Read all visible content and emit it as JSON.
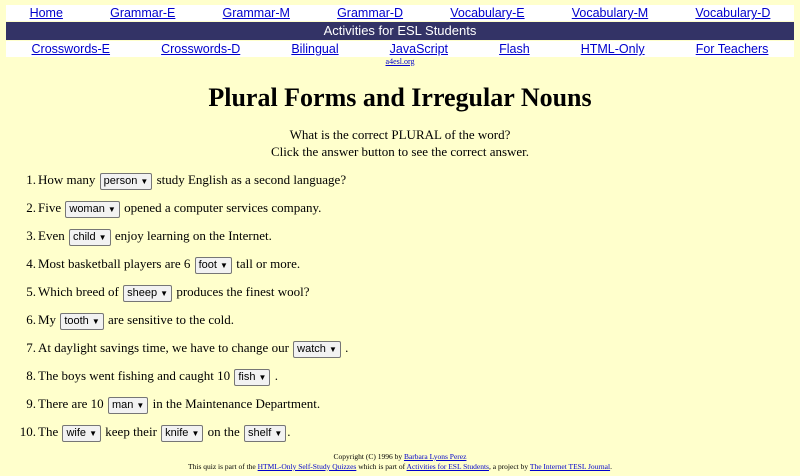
{
  "nav_top": [
    "Home",
    "Grammar-E",
    "Grammar-M",
    "Grammar-D",
    "Vocabulary-E",
    "Vocabulary-M",
    "Vocabulary-D"
  ],
  "banner": "Activities for ESL Students",
  "nav_bottom": [
    "Crosswords-E",
    "Crosswords-D",
    "Bilingual",
    "JavaScript",
    "Flash",
    "HTML-Only",
    "For Teachers"
  ],
  "site_link": "a4esl.org",
  "title": "Plural Forms and Irregular Nouns",
  "intro": [
    "What is the correct PLURAL of the word?",
    "Click the answer button to see the correct answer."
  ],
  "questions": [
    {
      "num": "1.",
      "parts": [
        "How many ",
        {
          "sel": "person"
        },
        " study English as a second language?"
      ]
    },
    {
      "num": "2.",
      "parts": [
        "Five ",
        {
          "sel": "woman"
        },
        " opened a computer services company."
      ]
    },
    {
      "num": "3.",
      "parts": [
        "Even ",
        {
          "sel": "child"
        },
        " enjoy learning on the Internet."
      ]
    },
    {
      "num": "4.",
      "parts": [
        "Most basketball players are 6 ",
        {
          "sel": "foot"
        },
        " tall or more."
      ]
    },
    {
      "num": "5.",
      "parts": [
        "Which breed of ",
        {
          "sel": "sheep"
        },
        " produces the finest wool?"
      ]
    },
    {
      "num": "6.",
      "parts": [
        "My ",
        {
          "sel": "tooth"
        },
        " are sensitive to the cold."
      ]
    },
    {
      "num": "7.",
      "parts": [
        "At daylight savings time, we have to change our ",
        {
          "sel": "watch"
        },
        " ."
      ]
    },
    {
      "num": "8.",
      "parts": [
        "The boys went fishing and caught 10 ",
        {
          "sel": "fish"
        },
        " ."
      ]
    },
    {
      "num": "9.",
      "parts": [
        "There are 10 ",
        {
          "sel": "man"
        },
        " in the Maintenance Department."
      ]
    },
    {
      "num": "10.",
      "parts": [
        "The ",
        {
          "sel": "wife"
        },
        " keep their ",
        {
          "sel": "knife"
        },
        " on the ",
        {
          "sel": "shelf"
        },
        "."
      ]
    }
  ],
  "footer": {
    "copyright": "Copyright (C) 1996 by ",
    "author": "Barbara Lyons Perez",
    "l2_a": "This quiz is part of the ",
    "link1": "HTML-Only Self-Study Quizzes",
    "l2_b": " which is part of ",
    "link2": "Activities for ESL Students",
    "l2_c": ", a project by ",
    "link3": "The Internet TESL Journal",
    "l2_d": "."
  },
  "icons": {
    "select_caret": "caret-down-icon"
  }
}
